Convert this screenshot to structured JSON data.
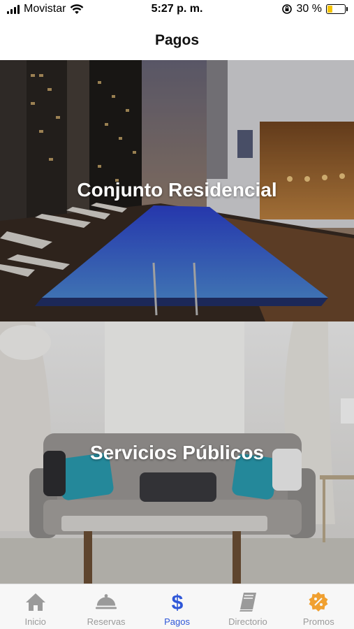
{
  "status_bar": {
    "carrier": "Movistar",
    "time": "5:27 p. m.",
    "battery_percent_label": "30 %",
    "battery_level": 0.3
  },
  "header": {
    "title": "Pagos"
  },
  "cards": [
    {
      "title": "Conjunto Residencial"
    },
    {
      "title": "Servicios Públicos"
    }
  ],
  "tab_bar": {
    "active_index": 2,
    "active_color": "#2f57d8",
    "inactive_color": "#9a9a9a",
    "promo_color": "#f0a030",
    "tabs": [
      {
        "label": "Inicio",
        "icon": "home-icon"
      },
      {
        "label": "Reservas",
        "icon": "cloche-icon"
      },
      {
        "label": "Pagos",
        "icon": "dollar-icon"
      },
      {
        "label": "Directorio",
        "icon": "book-icon"
      },
      {
        "label": "Promos",
        "icon": "discount-badge-icon"
      }
    ]
  }
}
